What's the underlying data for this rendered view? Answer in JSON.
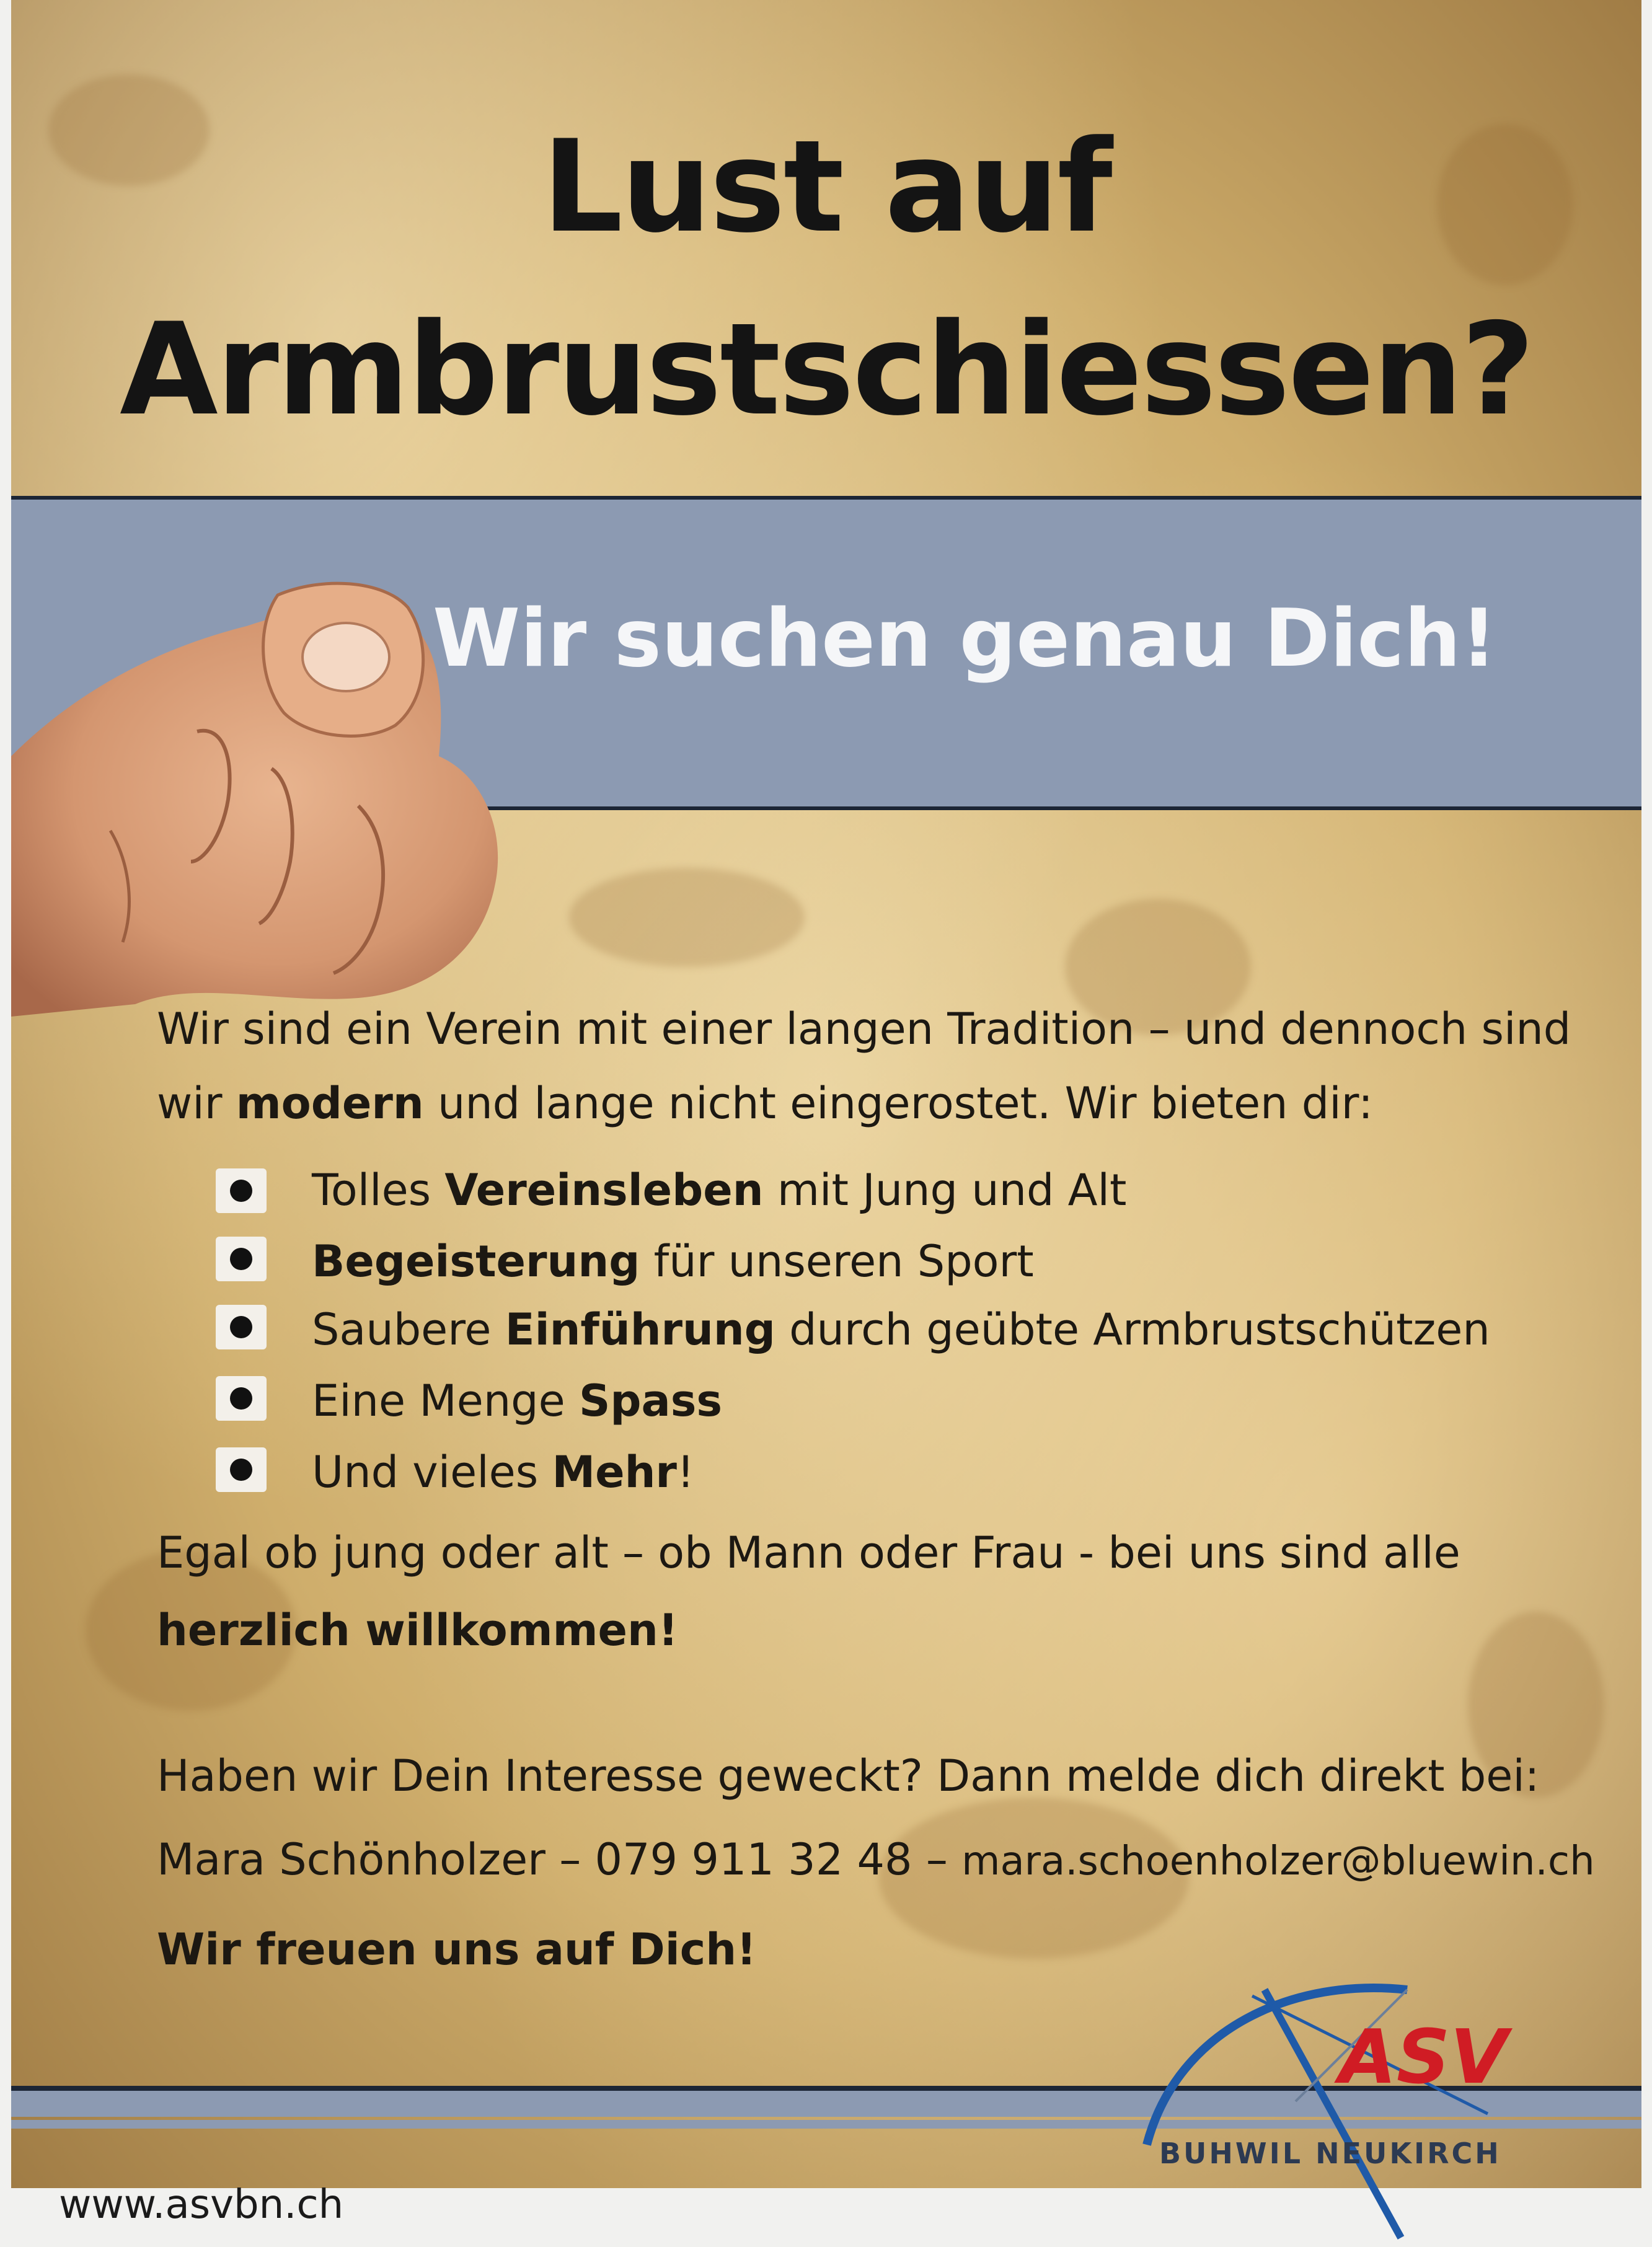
{
  "title": {
    "line1": "Lust auf",
    "line2": "Armbrustschiessen?"
  },
  "banner": {
    "text": "Wir suchen genau Dich!"
  },
  "intro": {
    "line1": "Wir sind ein Verein mit einer langen Tradition – und dennoch sind",
    "line2_a": "wir ",
    "line2_b": "modern",
    "line2_c": " und lange nicht eingerostet. Wir bieten dir:"
  },
  "bullets": [
    {
      "pre": "Tolles ",
      "bold": "Vereinsleben",
      "post": " mit Jung und Alt"
    },
    {
      "pre": "",
      "bold": "Begeisterung",
      "post": " für unseren Sport"
    },
    {
      "pre": "Saubere ",
      "bold": "Einführung",
      "post": " durch geübte Armbrustschützen"
    },
    {
      "pre": "Eine Menge ",
      "bold": "Spass",
      "post": ""
    },
    {
      "pre": "Und vieles ",
      "bold": "Mehr",
      "post": "!"
    }
  ],
  "welcome": {
    "line1": "Egal ob jung oder alt – ob Mann oder Frau - bei uns sind alle",
    "line2": "herzlich willkommen!"
  },
  "contact": {
    "question": "Haben wir Dein Interesse geweckt? Dann melde dich direkt bei:",
    "name": "Mara Schönholzer",
    "sep1": " – ",
    "phone": "079 911 32 48",
    "sep2": " – ",
    "email": "mara.schoenholzer@bluewin.ch",
    "closing": "Wir freuen uns auf Dich!"
  },
  "logo": {
    "text": "ASV",
    "sub": "BUHWIL NEUKIRCH"
  },
  "website": "www.asvbn.ch",
  "colors": {
    "banner": "#8c9ab2",
    "dark_rule": "#1c2535",
    "logo_red": "#d01c24",
    "logo_blue": "#1f5aa8"
  }
}
